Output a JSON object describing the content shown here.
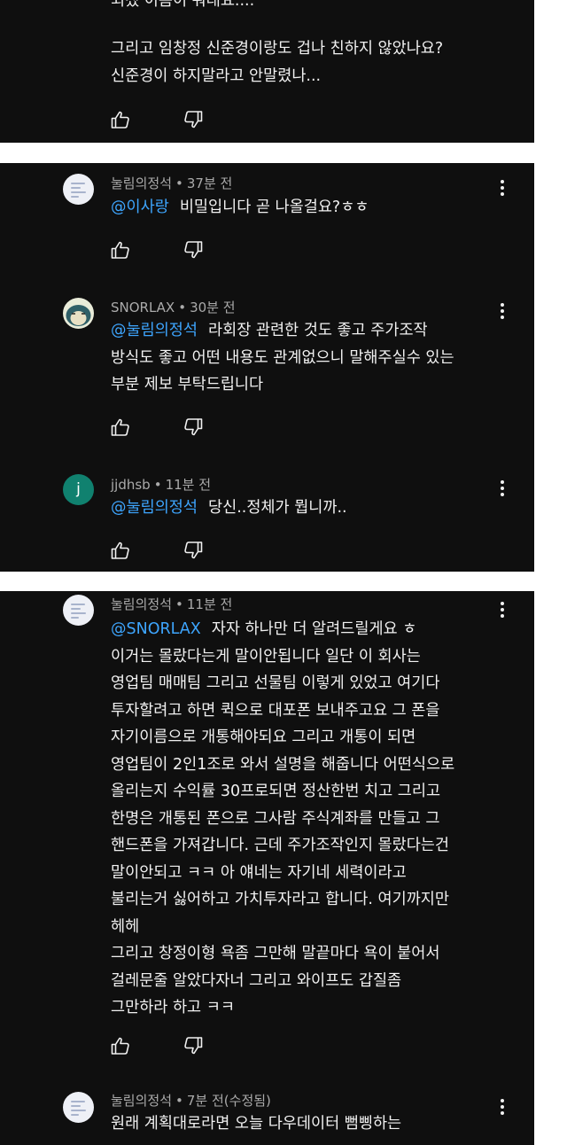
{
  "colors": {
    "panel_bg": "#0f0f0f",
    "text": "#f1f1f1",
    "meta": "#aaaaaa",
    "mention": "#3ea6ff",
    "page_bg": "#ffffff"
  },
  "icons": {
    "like": "thumbs-up-icon",
    "dislike": "thumbs-down-icon",
    "more": "more-vert-icon"
  },
  "comments": [
    {
      "text_top_cut": "되겠 이름이 뭐래요....",
      "text_lines": "그리고 임창정 신준경이랑도 겁나 친하지 않았나요?\n신준경이 하지말라고 안말렸나..."
    },
    {
      "author": "눌림의정석",
      "time": "37분 전",
      "mention": "@이사랑",
      "text": "비밀입니다 곧 나올걸요?ㅎㅎ"
    },
    {
      "author": "SNORLAX",
      "time": "30분 전",
      "mention": "@눌림의정석",
      "text": "라회장 관련한 것도 좋고 주가조작\n방식도 좋고 어떤 내용도 관계없으니 말해주실수 있는\n부분 제보 부탁드립니다"
    },
    {
      "author": "jjdhsb",
      "time": "11분 전",
      "avatar_letter": "j",
      "mention": "@눌림의정석",
      "text": "당신..정체가 뭡니까.."
    },
    {
      "author": "눌림의정석",
      "time": "11분 전",
      "mention": "@SNORLAX",
      "text": "자자 하나만 더 알려드릴게요 ㅎ\n이거는 몰랐다는게 말이안됩니다 일단 이 회사는\n영업팀 매매팀 그리고 선물팀 이렇게 있었고 여기다\n투자할려고 하면 퀵으로 대포폰 보내주고요 그 폰을\n자기이름으로 개통해야되요 그리고 개통이 되면\n영업팀이 2인1조로 와서 설명을 해줍니다 어떤식으로\n올리는지 수익률 30프로되면 정산한번 치고 그리고\n한명은 개통된 폰으로 그사람 주식계좌를 만들고 그\n핸드폰을 가져갑니다. 근데 주가조작인지 몰랐다는건\n말이안되고 ㅋㅋ 아 얘네는 자기네 세력이라고\n불리는거 싫어하고 가치투자라고 합니다. 여기까지만\n헤헤\n그리고 창정이형 욕좀 그만해 말끝마다 욕이 붙어서\n걸레문줄 알았다자너 그리고 와이프도 갑질좀\n그만하라 하고 ㅋㅋ"
    },
    {
      "author": "눌림의정석",
      "time": "7분 전(수정됨)",
      "text": "원래 계획대로라면 오늘 다우데이터 뻠삥하는"
    }
  ]
}
